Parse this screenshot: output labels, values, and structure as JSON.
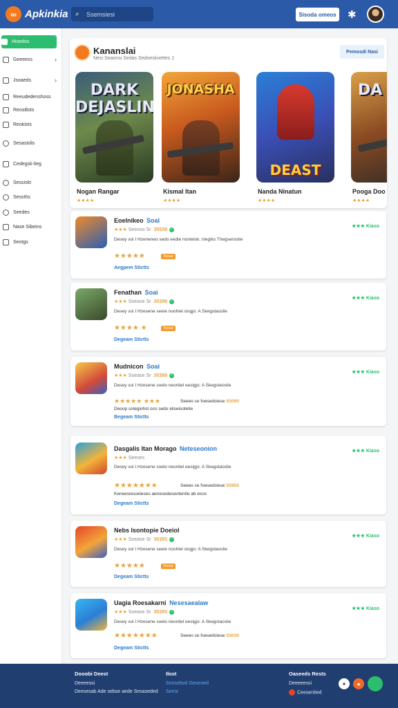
{
  "header": {
    "logo_text": "Apkinkia",
    "search_placeholder": "Ssemsiesi",
    "action_button": "Sisoda omeos"
  },
  "sidebar": {
    "items": [
      {
        "label": "Hisedso",
        "active": true,
        "arrow": false
      },
      {
        "label": "Geeeess",
        "active": false,
        "arrow": true
      },
      {
        "label": "Jsoaeds",
        "active": false,
        "arrow": true
      },
      {
        "label": "Reeudedenshoss",
        "active": false,
        "arrow": false
      },
      {
        "label": "Reostlists",
        "active": false,
        "arrow": false
      },
      {
        "label": "Reokists",
        "active": false,
        "arrow": false
      },
      {
        "label": "Sesasislis",
        "active": false,
        "arrow": false
      },
      {
        "label": "Cedegsk-lieg",
        "active": false,
        "arrow": false
      },
      {
        "label": "Sessiskt",
        "active": false,
        "arrow": false
      },
      {
        "label": "Sessths",
        "active": false,
        "arrow": false
      },
      {
        "label": "Seedes",
        "active": false,
        "arrow": false
      },
      {
        "label": "Nase Sibeins",
        "active": false,
        "arrow": false
      },
      {
        "label": "Seotgs",
        "active": false,
        "arrow": false
      }
    ]
  },
  "featured": {
    "title": "Kananslai",
    "subtitle": "Nesi Seaonsi Sedas  Sedoeskoettes   1",
    "button": "Pemosdi Nasi",
    "games": [
      {
        "name": "Nogan Rangar",
        "stars": "★★★★",
        "art_text": "DARK DEJASLIN"
      },
      {
        "name": "Kismal Itan",
        "stars": "★★★★",
        "art_text": "JONASHA"
      },
      {
        "name": "Nanda Ninatun",
        "stars": "★★★★",
        "art_text": "DEAST"
      },
      {
        "name": "Pooga Doo",
        "stars": "★★★★",
        "art_text": "DA"
      }
    ]
  },
  "list": [
    {
      "title": "Eoelnikeo",
      "tag": "Soai",
      "meta_stars": "★★★",
      "meta_text": "Seeoso Sr",
      "meta_num": "35539",
      "desc": "Desey soi I Hzeneneo sedo eedie nontelsk: niegiks Thegserostie",
      "rating": "★★★★★",
      "badge": "Teeee",
      "extra_pre": "",
      "extra_text": "",
      "extra_num": "",
      "extra_line": "",
      "link": "Aegpem Stictts",
      "right": "★★★ Kiaso"
    },
    {
      "title": "Fenathan",
      "tag": "Soai",
      "meta_stars": "★★★",
      "meta_text": "Soease Sr",
      "meta_num": "30399",
      "desc": "Desey soi I Hzesene seeie noohiel sisgjo: A Skegstaoslie",
      "rating": "★★★★ ★",
      "badge": "Teeee",
      "extra_pre": "",
      "extra_text": "",
      "extra_num": "",
      "extra_line": "",
      "link": "Degeam Stictts",
      "right": "★★★ Kiaso"
    },
    {
      "title": "Mudnicon",
      "tag": "Soai",
      "meta_stars": "★★★",
      "meta_text": "Soease Sr",
      "meta_num": "30389",
      "desc": "Desey soi I Hzesene soelo neonliel eesigjo: A Skegsteoslie",
      "rating": "★★★★★ ★★★",
      "badge": "",
      "extra_pre": "",
      "extra_text": "Seeeo ce foesedoiese",
      "extra_num": "S5090",
      "extra_line": "Deoop sstegiohst oco sedo eliseisotetie",
      "link": "Begeam Stictts",
      "right": "★★★ Kiaso"
    },
    {
      "title": "Dasgalis Itan Morago",
      "tag": "Neteseonion",
      "meta_stars": "★★★",
      "meta_text": "Seeses",
      "meta_num": "",
      "desc": "Desey soi I Hzesene soelo neonliel eesigjo: A Skegstaoslie",
      "rating": "★★★★★★★",
      "badge": "",
      "extra_pre": "",
      "extra_text": "Seeeo ce foesedoiese",
      "extra_num": "S5950",
      "extra_line": "Keneesiesoeieses aenesedeseotentie ab esos",
      "link": "Degeam Stictts",
      "right": "★★★ Kiaso"
    },
    {
      "title": "Nebs Isontopie Doeiol",
      "tag": "",
      "meta_stars": "★★★",
      "meta_text": "Soease Sr",
      "meta_num": "30393",
      "desc": "Desey soi I Hzesene seeie noohiel sisgjo: A Skegstaoslie",
      "rating": "★★★★★",
      "badge": "Teeee",
      "extra_pre": "",
      "extra_text": "",
      "extra_num": "",
      "extra_line": "",
      "link": "Degeam Stictts",
      "right": "★★★ Kiaso"
    },
    {
      "title": "Uagia Roesakarni",
      "tag": "Nesesaealaw",
      "meta_stars": "★★★",
      "meta_text": "Soease Sr",
      "meta_num": "30393",
      "desc": "Desey soi I Hzesene soelo neonliel eesigjo: A Skegstaoslie",
      "rating": "★★★★★★★",
      "badge": "",
      "extra_pre": "",
      "extra_text": "Seeeo ce foesedoiese",
      "extra_num": "S5030",
      "extra_line": "",
      "link": "Degeam Stictts",
      "right": "★★★ Kiaso"
    }
  ],
  "footer": {
    "col1": {
      "heading": "Dooobi Deest",
      "links": [
        "Deeeessi",
        "Deesesab Ade sebse aede Sesaseded"
      ]
    },
    "col2": {
      "heading": "Ilost",
      "links": [
        "Soosebod Geseoed",
        "Seest"
      ]
    },
    "col3": {
      "heading": "Oaseeds Rests",
      "links": [
        "Deeeeessi",
        "Ceesentied"
      ]
    }
  }
}
